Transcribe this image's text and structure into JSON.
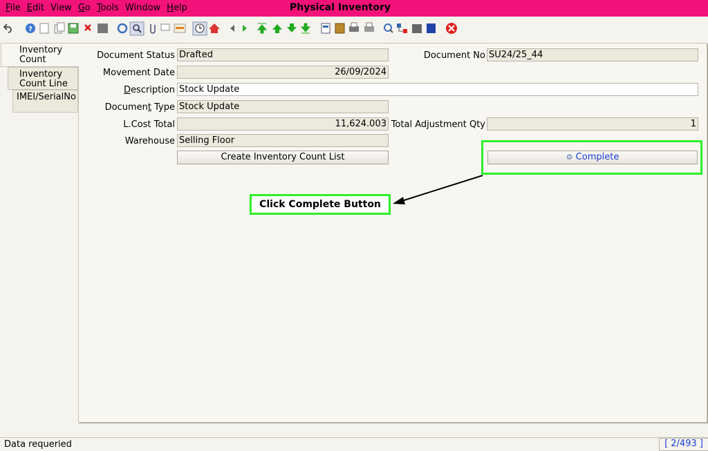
{
  "window": {
    "title": "Physical Inventory"
  },
  "menu": [
    {
      "label": "File",
      "mn": "F",
      "rest": "ile"
    },
    {
      "label": "Edit",
      "mn": "E",
      "rest": "dit"
    },
    {
      "label": "View",
      "mn": "",
      "rest": "View"
    },
    {
      "label": "Go",
      "mn": "G",
      "rest": "o"
    },
    {
      "label": "Tools",
      "mn": "T",
      "rest": "ools"
    },
    {
      "label": "Window",
      "mn": "",
      "rest": "Window"
    },
    {
      "label": "Help",
      "mn": "H",
      "rest": "elp"
    }
  ],
  "toolbar_icons": [
    "undo-icon",
    "help-icon",
    "new-record-icon",
    "copy-record-icon",
    "save-icon",
    "delete-icon",
    "print-preview-icon",
    "refresh-icon",
    "find-icon",
    "attachment-icon",
    "chat-icon",
    "history-icon",
    "home-icon",
    "back-icon",
    "forward-icon",
    "first-record-icon",
    "previous-record-icon",
    "next-record-icon",
    "last-record-icon",
    "report-icon",
    "archive-icon",
    "print-icon",
    "print-all-icon",
    "zoom-across-icon",
    "workflow-icon",
    "product-info-icon",
    "lock-icon",
    "exit-icon"
  ],
  "tabs": [
    {
      "label_line1": "Inventory",
      "label_line2": "Count"
    },
    {
      "label_line1": "Inventory",
      "label_line2": "Count Line"
    },
    {
      "label_line1": "IMEI/SerialNo",
      "label_line2": ""
    }
  ],
  "form": {
    "document_status": {
      "label": "Document Status",
      "value": "Drafted"
    },
    "document_no": {
      "label": "Document No",
      "value": "SU24/25_44"
    },
    "movement_date": {
      "label": "Movement Date",
      "value": "26/09/2024"
    },
    "description": {
      "label": "Description",
      "mn": "D",
      "rest": "escription",
      "value": "Stock Update"
    },
    "document_type": {
      "label": "Document Type",
      "pre": "Documen",
      "mn": "t",
      "post": " Type",
      "value": "Stock Update"
    },
    "lcost_total": {
      "label": "L.Cost Total",
      "value": "11,624.003"
    },
    "total_adjustment_qty": {
      "label": "Total Adjustment Qty",
      "value": "1"
    },
    "warehouse": {
      "label": "Warehouse",
      "value": "Selling Floor"
    },
    "create_list_button": "Create Inventory Count List",
    "complete_button": "Complete"
  },
  "annotation": {
    "text": "Click Complete Button"
  },
  "status": {
    "message": "Data requeried",
    "pager": "[ 2/493 ]"
  }
}
